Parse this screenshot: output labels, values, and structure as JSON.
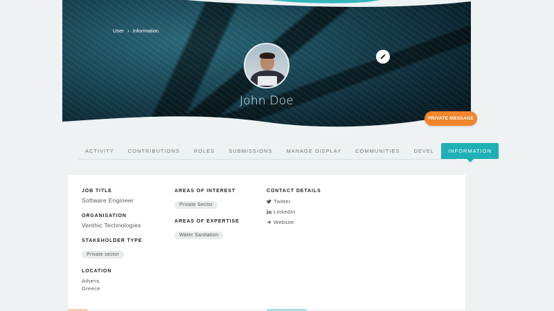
{
  "breadcrumb": {
    "items": [
      "User",
      "Information"
    ],
    "separator": "›"
  },
  "profile": {
    "name": "John Doe"
  },
  "actions": {
    "private_message": "PRIVATE MESSAGE",
    "edit_icon": "pencil-icon"
  },
  "tabs": [
    {
      "label": "ACTIVITY",
      "active": false
    },
    {
      "label": "CONTRIBUTIONS",
      "active": false
    },
    {
      "label": "ROLES",
      "active": false
    },
    {
      "label": "SUBMISSIONS",
      "active": false
    },
    {
      "label": "MANAGE DISPLAY",
      "active": false
    },
    {
      "label": "COMMUNITIES",
      "active": false
    },
    {
      "label": "DEVEL",
      "active": false
    },
    {
      "label": "INFORMATION",
      "active": true
    }
  ],
  "info": {
    "job_title": {
      "label": "JOB TITLE",
      "value": "Software Engineer"
    },
    "organisation": {
      "label": "ORGANISATION",
      "value": "Venthic Technologies"
    },
    "stakeholder_type": {
      "label": "STAKEHOLDER TYPE",
      "value": "Private sector"
    },
    "location": {
      "label": "LOCATION",
      "city": "Athens",
      "country": "Greece"
    },
    "areas_of_interest": {
      "label": "AREAS OF INTEREST",
      "value": "Private Sector"
    },
    "areas_of_expertise": {
      "label": "AREAS OF EXPERTISE",
      "value": "Water Sanitation"
    },
    "contact_details": {
      "label": "CONTACT DETAILS",
      "links": [
        {
          "label": "Twitter",
          "icon": "twitter-icon"
        },
        {
          "label": "LinkedIn",
          "icon": "linkedin-icon"
        },
        {
          "label": "Website",
          "icon": "arrow-right-icon"
        }
      ]
    }
  },
  "colors": {
    "accent": "#1fb0b5",
    "cta": "#f0852d",
    "background": "#eef2f3"
  }
}
